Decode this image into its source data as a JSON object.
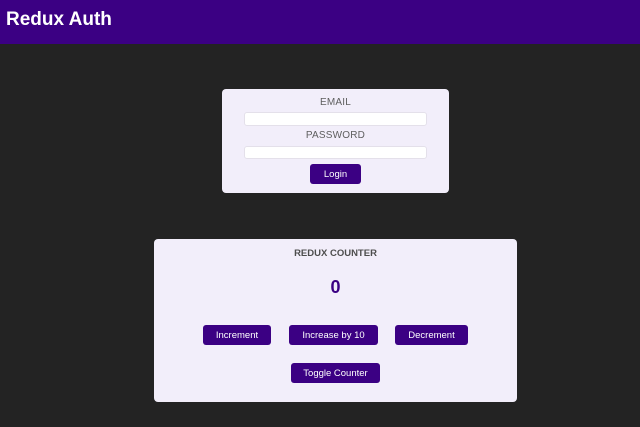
{
  "header": {
    "title": "Redux Auth"
  },
  "login": {
    "email_label": "EMAIL",
    "email_value": "",
    "password_label": "PASSWORD",
    "password_value": "",
    "login_button": "Login"
  },
  "counter": {
    "title": "REDUX COUNTER",
    "value": "0",
    "increment_button": "Increment",
    "increase_by_10_button": "Increase by 10",
    "decrement_button": "Decrement",
    "toggle_button": "Toggle Counter"
  },
  "colors": {
    "accent": "#3b0083",
    "background": "#232323",
    "card": "#f2eefa"
  }
}
